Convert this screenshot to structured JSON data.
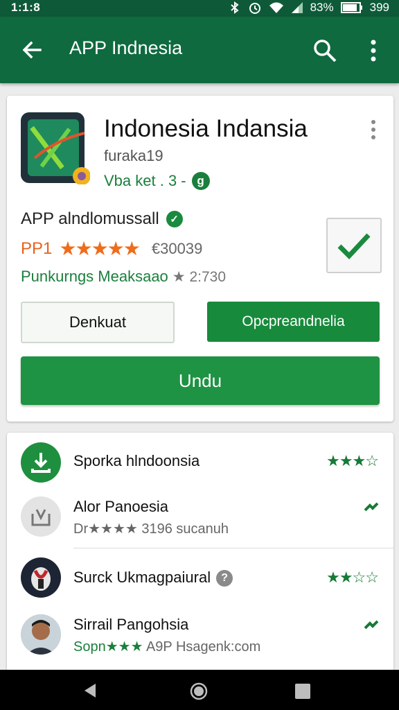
{
  "status_bar": {
    "time": "1:1:8",
    "battery": "83%",
    "extra": "399"
  },
  "toolbar": {
    "title": "APP Indnesia"
  },
  "app": {
    "title": "Indonesia Indansia",
    "developer": "furaka19",
    "meta": "Vba ket . 3 -",
    "meta_badge": "g",
    "name": "APP alndlomussall",
    "name_badge": "✓",
    "rating_prefix": "PP1",
    "stars": "★★★★★",
    "rating_count": "€30039",
    "subline": "Punkurngs Meaksaao",
    "subline_stat": "★ 2:730",
    "btn_left": "Denkuat",
    "btn_right": "Opcpreandnelia",
    "install": "Undu"
  },
  "list": [
    {
      "title": "Sporka hlndoonsia",
      "subtitle": "",
      "rating": "★★★☆"
    },
    {
      "title": "Alor Panoesia",
      "subtitle": "Dr★★★★ 3196 sucanuh",
      "rating": ""
    },
    {
      "title": "Surck Ukmagpaiural",
      "subtitle": "",
      "help": "?",
      "rating": "★★☆☆"
    },
    {
      "title": "Sirrail Pangohsia",
      "subtitle_green": "Sopn★★★",
      "subtitle": "A9P Hsagenk:com",
      "rating": ""
    }
  ],
  "colors": {
    "toolbar": "#0f6a3f",
    "accent": "#1e9343",
    "star_orange": "#ef6c1a"
  },
  "icons": [
    "back-arrow-icon",
    "search-icon",
    "more-vert-icon",
    "check-icon",
    "download-icon",
    "app-icon"
  ]
}
